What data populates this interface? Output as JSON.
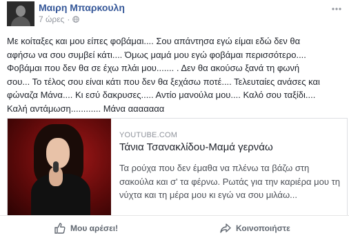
{
  "post": {
    "author": "Μαιρη Μπαρκουλη",
    "time": "7 ώρες",
    "separator": "·",
    "audience_icon": "globe-icon",
    "options_icon": "more-options-icon",
    "text_lines": [
      "Με κοίταξες και μου είπες φοβάμαι.... Σου απάντησα εγώ είμαι εδώ δεν θα",
      "αφήσω να σου συμβεί κάτι.... Όμως μαμά μου εγώ φοβάμαι περισσότερο....",
      "Φοβάμαι που δεν θα σε έχω πλάι μου....... . Δεν θα ακούσω ξανά τη φωνή",
      "σου... Το τέλος σου είναι κάτι που δεν θα ξεχάσω ποτέ.... Τελευταίες ανάσες και",
      "φώναζα Μάνα.... Κι εσύ δακρυσες..... Αντίο μανούλα μου.... Καλό σου ταξίδι....",
      "Καλή αντάμωση............ Μάνα ααααααα"
    ]
  },
  "link_preview": {
    "source": "YOUTUBE.COM",
    "title": "Τάνια Τσανακλίδου-Μαμά γερνάω",
    "description_lines": [
      "Τα ρούχα που δεν έμαθα να πλένω τα βάζω στη",
      "σακούλα και σ' τα φέρνω. Ρωτάς για την καριέρα μου τη",
      "νύχτα και τη μέρα μου κι εγώ να σου μιλάω..."
    ]
  },
  "actions": {
    "like_label": "Μου αρέσει!",
    "share_label": "Κοινοποιήστε",
    "like_icon": "thumbs-up-icon",
    "share_icon": "share-arrow-icon"
  },
  "colors": {
    "author_link": "#365899",
    "meta_text": "#90949c",
    "body_text": "#1d2129",
    "action_text": "#606770"
  }
}
